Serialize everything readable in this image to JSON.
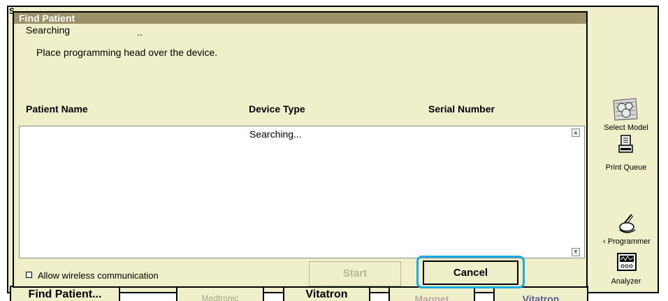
{
  "outer": {
    "title_letter": "S"
  },
  "dialog": {
    "title": "Find Patient",
    "status_label": "Searching",
    "status_dots": "..",
    "instruction": "Place programming head over the device.",
    "columns": [
      "Patient Name",
      "Device Type",
      "Serial Number"
    ],
    "list_status": "Searching...",
    "checkbox_label": "Allow wireless communication",
    "checkbox_checked": false,
    "start_label": "Start",
    "cancel_label": "Cancel"
  },
  "sidebar": {
    "select_model": "Select Model",
    "print_queue": "Print Queue",
    "programmer": "‹ Programmer",
    "analyzer": "Analyzer"
  },
  "bottom_bar": {
    "find_patient": "Find Patient...",
    "medtronic": "Medtronic",
    "vitatron": "Vitatron",
    "magnet": "Magnet",
    "extra": "Vitatron"
  },
  "colors": {
    "panel_bg": "#efefca",
    "title_bar": "#9c9168",
    "highlight": "#1aa9e0"
  }
}
